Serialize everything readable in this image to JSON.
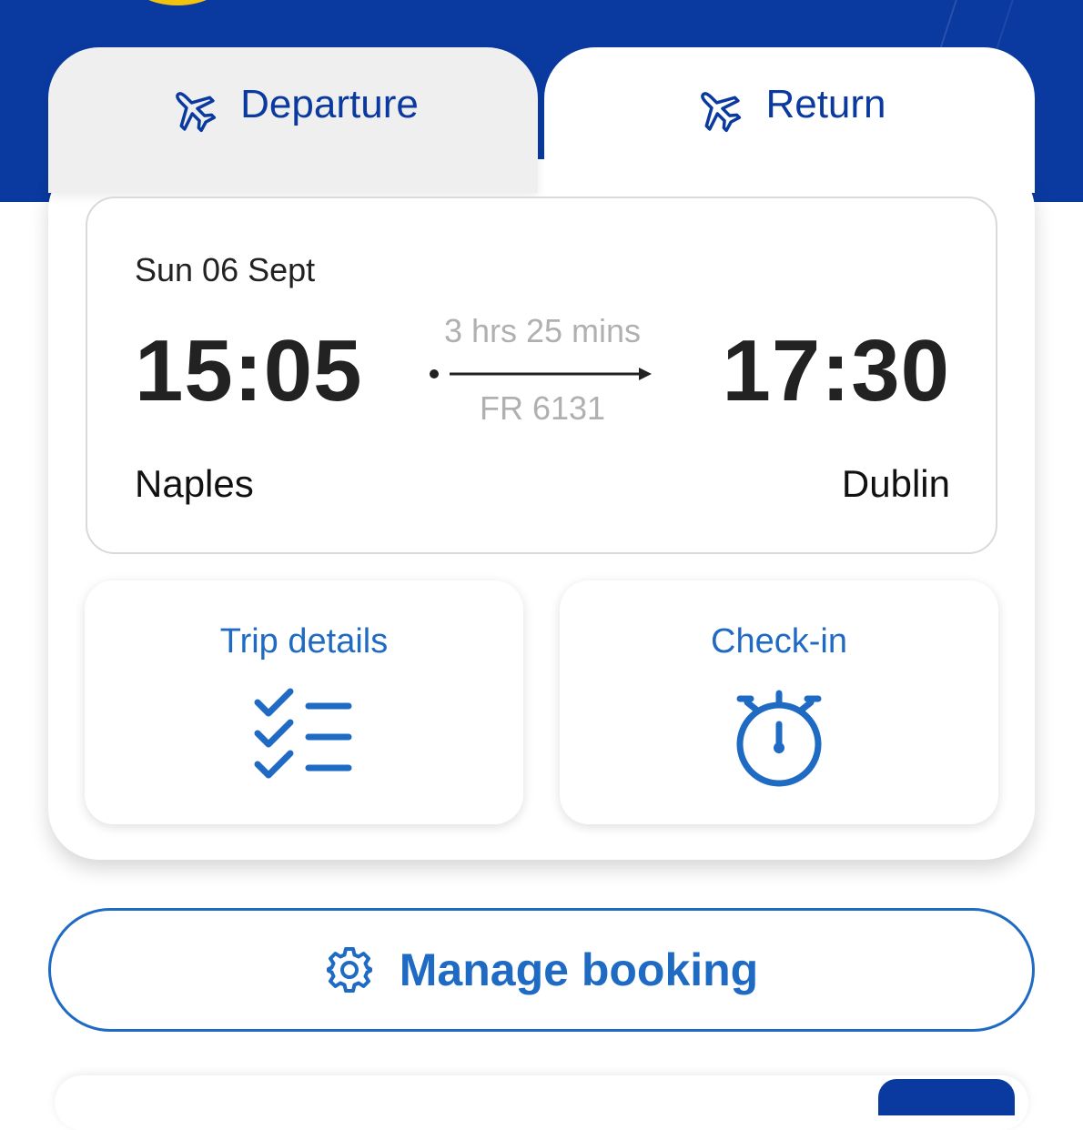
{
  "tabs": {
    "departure_label": "Departure",
    "return_label": "Return"
  },
  "flight": {
    "date": "Sun 06 Sept",
    "departure_time": "15:05",
    "arrival_time": "17:30",
    "duration": "3 hrs 25 mins",
    "flight_number": "FR 6131",
    "origin": "Naples",
    "destination": "Dublin"
  },
  "actions": {
    "trip_details_label": "Trip details",
    "check_in_label": "Check-in"
  },
  "manage_booking_label": "Manage booking",
  "icons": {
    "tab_icon": "airplane-icon",
    "trip_details_icon": "checklist-icon",
    "check_in_icon": "stopwatch-icon",
    "manage_icon": "gear-icon"
  },
  "colors": {
    "brand_blue": "#0a3aa0",
    "accent_blue": "#1f6bc4",
    "logo_yellow": "#f1c40f"
  }
}
